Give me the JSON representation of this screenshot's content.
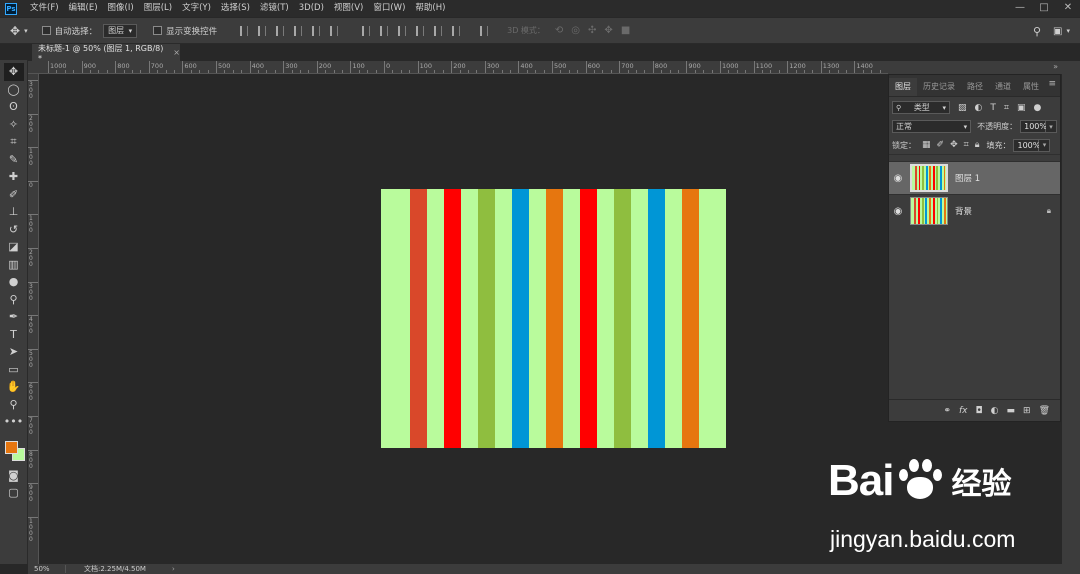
{
  "menubar": {
    "logo": "Ps",
    "items": [
      "文件(F)",
      "编辑(E)",
      "图像(I)",
      "图层(L)",
      "文字(Y)",
      "选择(S)",
      "滤镜(T)",
      "3D(D)",
      "视图(V)",
      "窗口(W)",
      "帮助(H)"
    ],
    "window_controls": [
      "—",
      "□",
      "✕"
    ]
  },
  "options": {
    "auto_select_label": "自动选择：",
    "auto_select_value": "图层",
    "show_transform_label": "显示变换控件",
    "mode3d_label": "3D 模式："
  },
  "document_tab": {
    "title": "未标题-1 @ 50% (图层 1, RGB/8) *",
    "close": "×"
  },
  "ruler": {
    "top_labels": [
      "1000",
      "900",
      "800",
      "700",
      "600",
      "500",
      "400",
      "300",
      "200",
      "100",
      "0",
      "100",
      "200",
      "300",
      "400",
      "500",
      "600",
      "700",
      "800",
      "900",
      "1000",
      "1100",
      "1200",
      "1300",
      "1400"
    ],
    "left_labels": [
      "300",
      "200",
      "100",
      "0",
      "100",
      "200",
      "300",
      "400",
      "500",
      "600",
      "700",
      "800",
      "900",
      "1000"
    ]
  },
  "canvas": {
    "background_color": "#b9fb9c",
    "stripe_colors": [
      "#d9482a",
      "#ff0000",
      "#8fbe3f",
      "#0096d6",
      "#e6760f",
      "#ff0000",
      "#8fbe3f",
      "#0096d6",
      "#e6760f"
    ]
  },
  "layers_panel": {
    "tabs": [
      "图层",
      "历史记录",
      "路径",
      "通道",
      "属性"
    ],
    "filter_label": "类型",
    "blend_mode": "正常",
    "opacity_label": "不透明度：",
    "opacity_value": "100%",
    "lock_label": "锁定：",
    "fill_label": "填充：",
    "fill_value": "100%",
    "layers": [
      {
        "name": "图层 1",
        "selected": true,
        "locked": false
      },
      {
        "name": "背景",
        "selected": false,
        "locked": true
      }
    ]
  },
  "statusbar": {
    "zoom": "50%",
    "doc_info": "文档:2.25M/4.50M",
    "arrow": "›"
  },
  "watermark": {
    "brand_left": "Bai",
    "brand_right": "经验",
    "url": "jingyan.baidu.com"
  }
}
